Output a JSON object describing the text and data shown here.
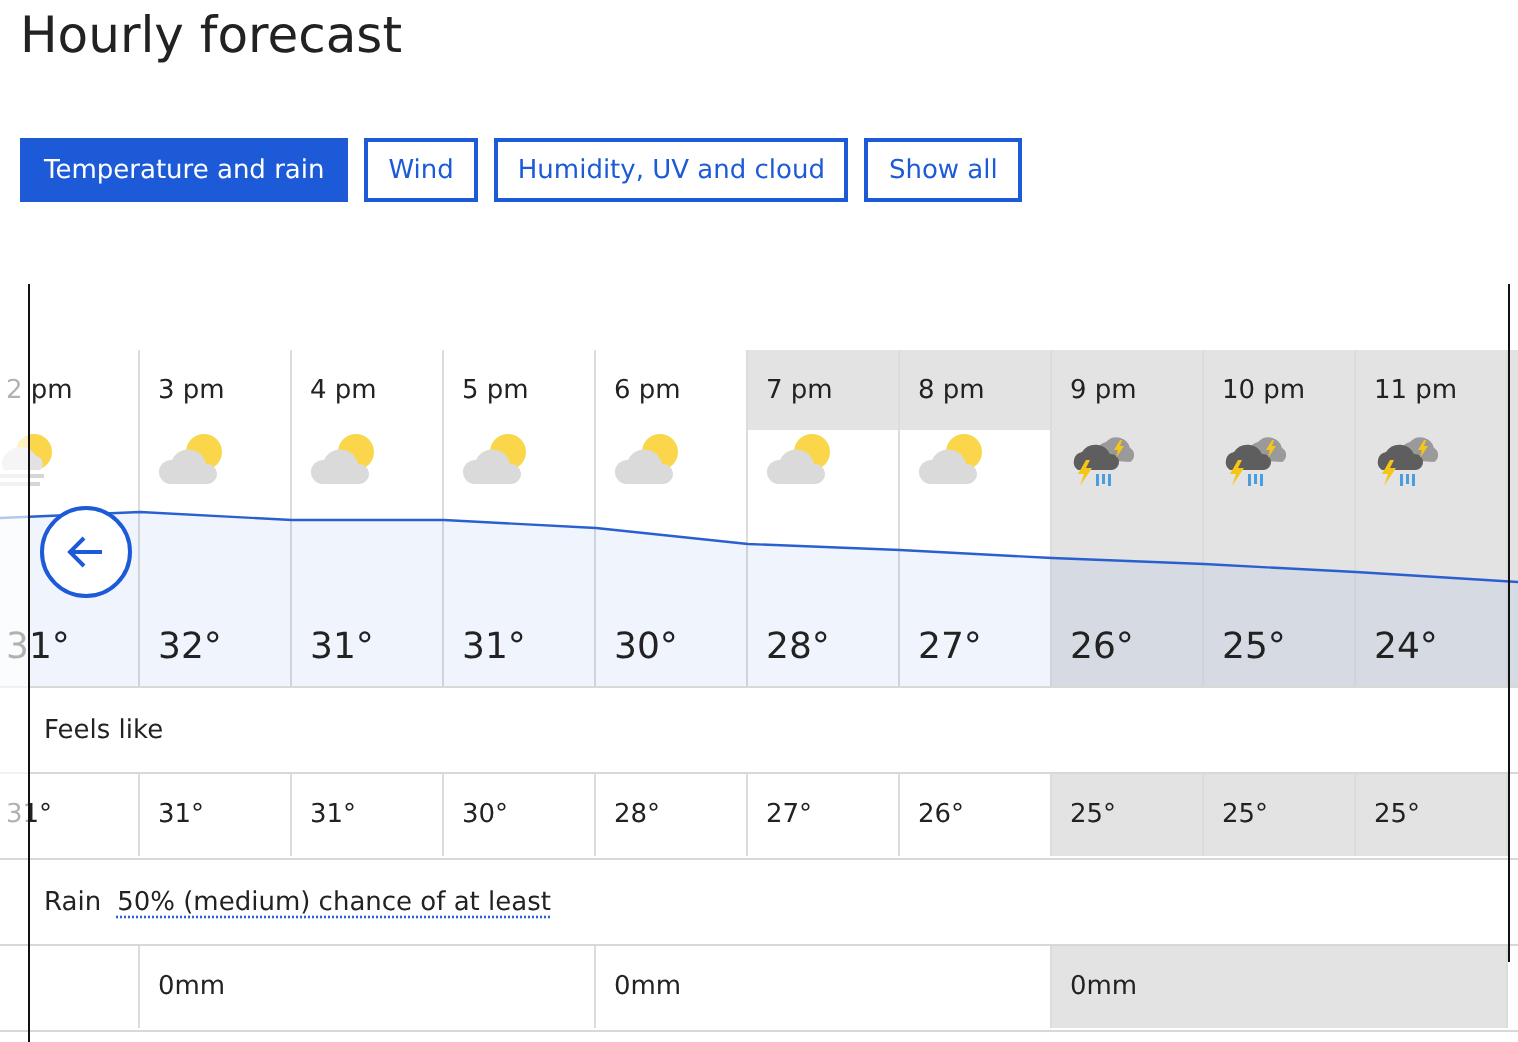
{
  "title": "Hourly forecast",
  "tabs": [
    {
      "label": "Temperature and rain",
      "selected": true
    },
    {
      "label": "Wind",
      "selected": false
    },
    {
      "label": "Humidity, UV and cloud",
      "selected": false
    },
    {
      "label": "Show all",
      "selected": false
    }
  ],
  "hours": [
    {
      "time": "2 pm",
      "kind": "mist",
      "temperature": "31°",
      "feels_like": "31°",
      "header_shaded": false,
      "night": false
    },
    {
      "time": "3 pm",
      "kind": "cloudy",
      "temperature": "32°",
      "feels_like": "31°",
      "header_shaded": false,
      "night": false
    },
    {
      "time": "4 pm",
      "kind": "cloudy",
      "temperature": "31°",
      "feels_like": "31°",
      "header_shaded": false,
      "night": false
    },
    {
      "time": "5 pm",
      "kind": "cloudy",
      "temperature": "31°",
      "feels_like": "30°",
      "header_shaded": false,
      "night": false
    },
    {
      "time": "6 pm",
      "kind": "cloudy",
      "temperature": "30°",
      "feels_like": "28°",
      "header_shaded": false,
      "night": false
    },
    {
      "time": "7 pm",
      "kind": "cloudy",
      "temperature": "28°",
      "feels_like": "27°",
      "header_shaded": true,
      "night": false
    },
    {
      "time": "8 pm",
      "kind": "cloudy",
      "temperature": "27°",
      "feels_like": "26°",
      "header_shaded": true,
      "night": false
    },
    {
      "time": "9 pm",
      "kind": "storm",
      "temperature": "26°",
      "feels_like": "25°",
      "header_shaded": true,
      "night": true
    },
    {
      "time": "10 pm",
      "kind": "storm",
      "temperature": "25°",
      "feels_like": "25°",
      "header_shaded": true,
      "night": true
    },
    {
      "time": "11 pm",
      "kind": "storm",
      "temperature": "24°",
      "feels_like": "25°",
      "header_shaded": true,
      "night": true
    }
  ],
  "feels_like_label": "Feels like",
  "rain": {
    "label": "Rain",
    "chance": "50% (medium) chance of at least",
    "cells": [
      {
        "amount": "0mm",
        "night": false
      },
      {
        "amount": "0mm",
        "night": false
      },
      {
        "amount": "0mm",
        "night": true
      }
    ]
  }
}
